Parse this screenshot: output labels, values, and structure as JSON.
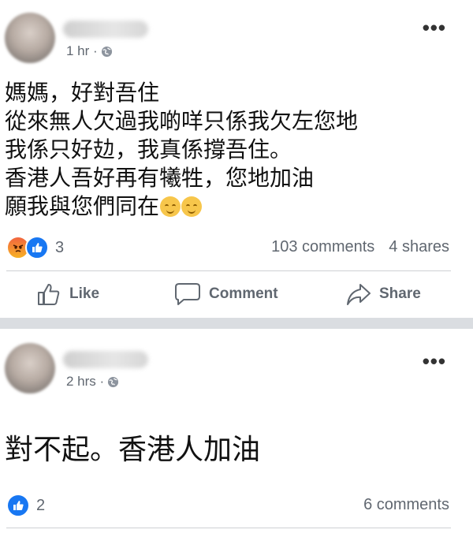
{
  "posts": [
    {
      "time": "1 hr ·",
      "body_lines": [
        "媽媽，好對吾住",
        "從來無人欠過我啲咩只係我欠左您地",
        "我係只好攰，我真係撐吾住。",
        "香港人吾好再有犧牲，您地加油",
        "願我與您們同在"
      ],
      "reaction_icons": [
        "angry-icon",
        "like-icon"
      ],
      "reaction_count": "3",
      "comments": "103 comments",
      "shares": "4 shares",
      "actions": {
        "like": "Like",
        "comment": "Comment",
        "share": "Share"
      }
    },
    {
      "time": "2 hrs ·",
      "body_lines": [
        "對不起。香港人加油"
      ],
      "reaction_icons": [
        "like-icon"
      ],
      "reaction_count": "2",
      "comments": "6 comments"
    }
  ],
  "colors": {
    "like_blue": "#1877f2",
    "separator": "#dadde1",
    "muted_text": "#606770"
  }
}
